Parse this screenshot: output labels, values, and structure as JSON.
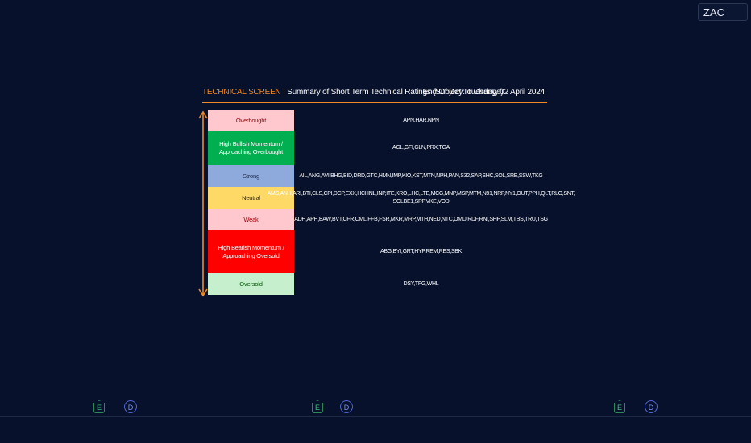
{
  "symbol": "ZAC",
  "header": {
    "accent": "TECHNICAL SCREEN",
    "separator": " | ",
    "title": "Summary of Short Term Technical Ratings (Subject To Change)",
    "date": "End Of Day: Tuesday, 02 April 2024"
  },
  "ratings": [
    {
      "label": "Overbought",
      "tickers": "APN,HAR,NPN",
      "bg": "#ffc7ce",
      "fg": "#9c0006"
    },
    {
      "label": "High Bullish Momentum / Approaching Overbought",
      "tickers": "AGL,GFI,GLN,PRX,TGA",
      "bg": "#00b050",
      "fg": "#ffffff"
    },
    {
      "label": "Strong",
      "tickers": "AIL,ANG,AVI,BHG,BID,DRD,GTC,HMN,IMP,KIO,KST,MTN,NPH,PAN,S32,SAP,SHC,SOL,SRE,SSW,TKG",
      "bg": "#8ea9db",
      "fg": "#1f2d4d"
    },
    {
      "label": "Neutral",
      "tickers": "AMS,ANH,ARI,BTI,CLS,CPI,DCP,EXX,HCI,INL,INP,ITE,KRO,LHC,LTE,MCG,MNP,MSP,MTM,N91,NRP,NY1,OUT,PPH,QLT,RLO,SNT, SOLBE1,SPP,VKE,VOD",
      "bg": "#ffd966",
      "fg": "#3a2c00"
    },
    {
      "label": "Weak",
      "tickers": "ADH,APH,BAW,BVT,CFR,CML,FFB,FSR,MKR,MRP,MTH,NED,NTC,OMU,RDF,RNI,SHP,SLM,TBS,TRU,TSG",
      "bg": "#ffc7ce",
      "fg": "#9c0006"
    },
    {
      "label": "High Bearish Momentum / Approaching Oversold",
      "tickers": "ABG,BYI,GRT,HYP,REM,RES,SBK",
      "bg": "#ff0000",
      "fg": "#ffffff"
    },
    {
      "label": "Oversold",
      "tickers": "DSY,TFG,WHL",
      "bg": "#c6efce",
      "fg": "#006100"
    }
  ],
  "badges": [
    {
      "kind": "e",
      "text": "E"
    },
    {
      "kind": "d",
      "text": "D"
    },
    {
      "kind": "e",
      "text": "E"
    },
    {
      "kind": "d",
      "text": "D"
    },
    {
      "kind": "e",
      "text": "E"
    },
    {
      "kind": "d",
      "text": "D"
    }
  ],
  "colors": {
    "background": "#07112b",
    "accent": "#f08a24"
  }
}
